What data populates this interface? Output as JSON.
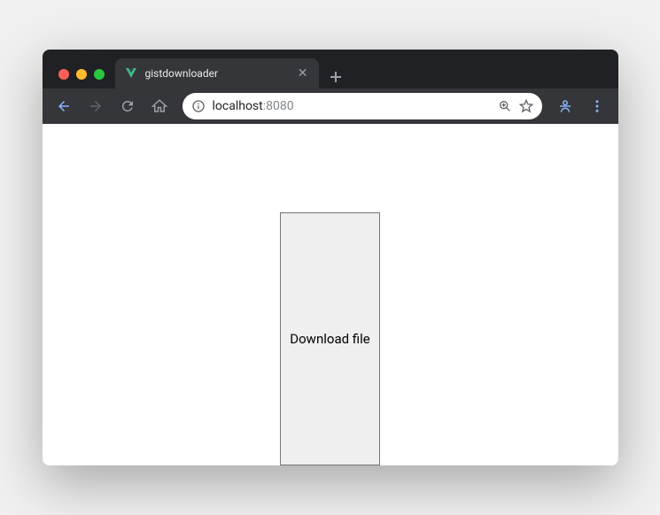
{
  "tab": {
    "title": "gistdownloader",
    "favicon": "vue"
  },
  "address": {
    "host": "localhost",
    "port": ":8080"
  },
  "page": {
    "button_label": "Download file"
  }
}
